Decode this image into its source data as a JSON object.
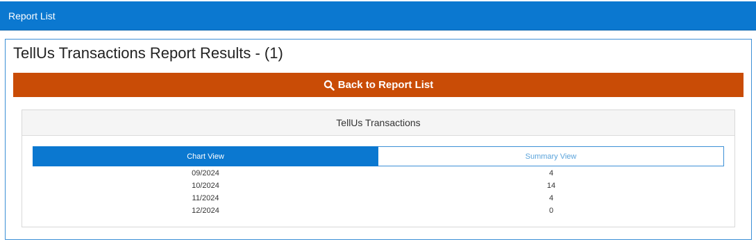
{
  "header": {
    "title": "Report List"
  },
  "page": {
    "title": "TellUs Transactions Report Results - (1)"
  },
  "back_button": {
    "label": "Back to Report List",
    "icon": "search-icon"
  },
  "card": {
    "title": "TellUs Transactions",
    "tabs": [
      {
        "label": "Chart View",
        "active": true
      },
      {
        "label": "Summary View",
        "active": false
      }
    ],
    "rows": [
      {
        "period": "09/2024",
        "count": "4"
      },
      {
        "period": "10/2024",
        "count": "14"
      },
      {
        "period": "11/2024",
        "count": "4"
      },
      {
        "period": "12/2024",
        "count": "0"
      }
    ]
  },
  "colors": {
    "header_blue": "#0b78d0",
    "button_orange": "#c94c06",
    "inactive_tab_text": "#5aa3db"
  }
}
